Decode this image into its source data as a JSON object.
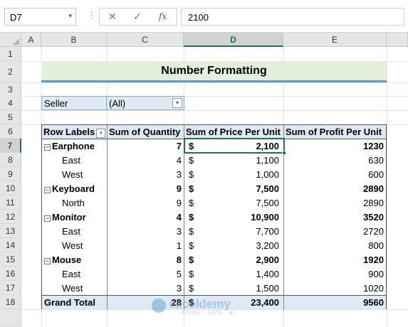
{
  "formula_bar": {
    "name_box": "D7",
    "name_box_caret": "▾",
    "separator": "⋮",
    "cancel_glyph": "✕",
    "enter_glyph": "✓",
    "fx_label": "fx",
    "formula": "2100"
  },
  "columns": [
    "A",
    "B",
    "C",
    "D",
    "E"
  ],
  "selected_column": "D",
  "rows": [
    "1",
    "2",
    "3",
    "4",
    "5",
    "6",
    "7",
    "8",
    "9",
    "10",
    "11",
    "12",
    "13",
    "14",
    "15",
    "16",
    "17",
    "18"
  ],
  "selected_row": "7",
  "sheet": {
    "title": "Number Formatting",
    "filter": {
      "label": "Seller",
      "value": "(All)"
    },
    "pivot": {
      "headers": [
        "Row Labels",
        "Sum of Quantity",
        "Sum of Price Per Unit",
        "Sum of Profit Per Unit"
      ],
      "rows": [
        {
          "label": "Earphone",
          "qty": "7",
          "price": "2,100",
          "profit": "1230"
        },
        {
          "label": "East",
          "qty": "4",
          "price": "1,100",
          "profit": "630"
        },
        {
          "label": "West",
          "qty": "3",
          "price": "1,000",
          "profit": "600"
        },
        {
          "label": "Keyboard",
          "qty": "9",
          "price": "7,500",
          "profit": "2890"
        },
        {
          "label": "North",
          "qty": "9",
          "price": "7,500",
          "profit": "2890"
        },
        {
          "label": "Monitor",
          "qty": "4",
          "price": "10,900",
          "profit": "3520"
        },
        {
          "label": "East",
          "qty": "3",
          "price": "7,700",
          "profit": "2720"
        },
        {
          "label": "West",
          "qty": "1",
          "price": "3,200",
          "profit": "800"
        },
        {
          "label": "Mouse",
          "qty": "8",
          "price": "2,900",
          "profit": "1920"
        },
        {
          "label": "East",
          "qty": "5",
          "price": "1,400",
          "profit": "900"
        },
        {
          "label": "West",
          "qty": "3",
          "price": "1,500",
          "profit": "1020"
        }
      ],
      "total": {
        "label": "Grand Total",
        "qty": "28",
        "price": "23,400",
        "profit": "9560"
      },
      "currency_symbol": "$",
      "collapse_glyph": "−",
      "dropdown_glyph": "▾"
    }
  },
  "watermark": {
    "brand": "exceldemy",
    "tagline": "EXCEL · DATA · BI"
  },
  "colors": {
    "accent": "#217346",
    "title_fill": "#e2efda",
    "title_underline": "#5b9bd5",
    "pivot_header_fill": "#dde9f5"
  }
}
